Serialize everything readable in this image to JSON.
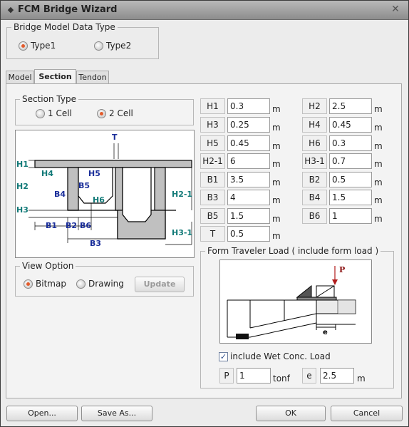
{
  "window": {
    "title": "FCM Bridge Wizard"
  },
  "bridge_model": {
    "legend": "Bridge Model Data Type",
    "options": [
      "Type1",
      "Type2"
    ],
    "selected": "Type1"
  },
  "tabs": [
    {
      "label": "Model"
    },
    {
      "label": "Section"
    },
    {
      "label": "Tendon"
    }
  ],
  "section_type": {
    "legend": "Section Type",
    "options": [
      "1 Cell",
      "2 Cell"
    ],
    "selected": "2 Cell"
  },
  "section_diagram": {
    "labels": {
      "T": "T",
      "H1": "H1",
      "H2": "H2",
      "H3": "H3",
      "H4": "H4",
      "H5": "H5",
      "H6": "H6",
      "B1": "B1",
      "B2": "B2",
      "B3": "B3",
      "B4": "B4",
      "B5": "B5",
      "B6": "B6",
      "H2_1": "H2-1",
      "H3_1": "H3-1"
    }
  },
  "view_option": {
    "legend": "View Option",
    "options": [
      "Bitmap",
      "Drawing"
    ],
    "selected": "Bitmap",
    "update_label": "Update"
  },
  "params": [
    {
      "left": {
        "label": "H1",
        "value": "0.3"
      },
      "right": {
        "label": "H2",
        "value": "2.5"
      }
    },
    {
      "left": {
        "label": "H3",
        "value": "0.25"
      },
      "right": {
        "label": "H4",
        "value": "0.45"
      }
    },
    {
      "left": {
        "label": "H5",
        "value": "0.45"
      },
      "right": {
        "label": "H6",
        "value": "0.3"
      }
    },
    {
      "left": {
        "label": "H2-1",
        "value": "6"
      },
      "right": {
        "label": "H3-1",
        "value": "0.7"
      }
    },
    {
      "left": {
        "label": "B1",
        "value": "3.5"
      },
      "right": {
        "label": "B2",
        "value": "0.5"
      }
    },
    {
      "left": {
        "label": "B3",
        "value": "4"
      },
      "right": {
        "label": "B4",
        "value": "1.5"
      }
    },
    {
      "left": {
        "label": "B5",
        "value": "1.5"
      },
      "right": {
        "label": "B6",
        "value": "1"
      }
    },
    {
      "left": {
        "label": "T",
        "value": "0.5"
      }
    }
  ],
  "unit_m": "m",
  "form_traveler": {
    "legend": "Form Traveler Load ( include form load )",
    "diagram": {
      "p_label": "P",
      "e_label": "e"
    },
    "include_wet_label": "include Wet Conc. Load",
    "include_wet_checked": true,
    "p_label": "P",
    "p_value": "1",
    "p_unit": "tonf",
    "e_label": "e",
    "e_value": "2.5",
    "e_unit": "m"
  },
  "footer": {
    "open_label": "Open...",
    "save_as_label": "Save As...",
    "ok_label": "OK",
    "cancel_label": "Cancel"
  }
}
